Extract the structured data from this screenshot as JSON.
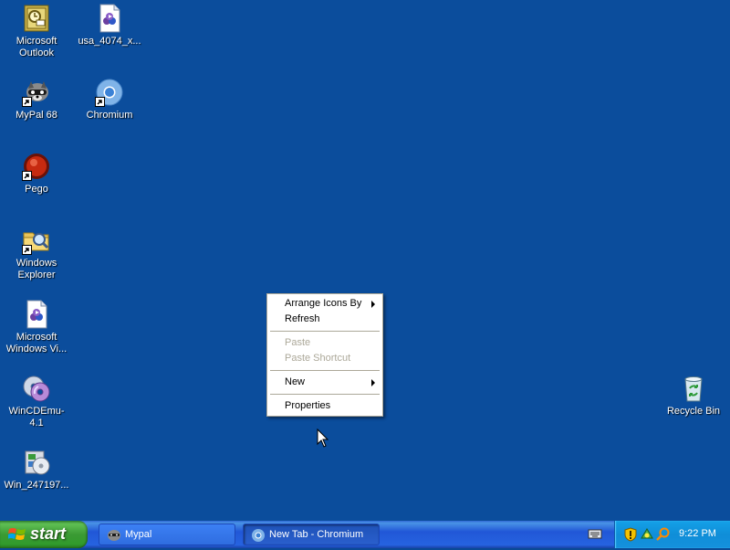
{
  "desktop": {
    "icons": [
      {
        "label": "Microsoft Outlook",
        "icon": "outlook-icon"
      },
      {
        "label": "usa_4074_x...",
        "icon": "media-file-icon"
      },
      {
        "label": "MyPal 68",
        "icon": "mypal-icon"
      },
      {
        "label": "Chromium",
        "icon": "chromium-icon"
      },
      {
        "label": "Pego",
        "icon": "pego-icon"
      },
      {
        "label": "Windows Explorer",
        "icon": "explorer-icon"
      },
      {
        "label": "Microsoft Windows Vi...",
        "icon": "media-file-icon"
      },
      {
        "label": "WinCDEmu-4.1",
        "icon": "cd-icon"
      },
      {
        "label": "Win_247197...",
        "icon": "installer-icon"
      },
      {
        "label": "Recycle Bin",
        "icon": "recycle-bin-icon"
      }
    ]
  },
  "context_menu": {
    "arrange": "Arrange Icons By",
    "refresh": "Refresh",
    "paste": "Paste",
    "paste_shortcut": "Paste Shortcut",
    "new": "New",
    "properties": "Properties"
  },
  "taskbar": {
    "start_label": "start",
    "tasks": [
      {
        "label": "Mypal",
        "active": false
      },
      {
        "label": "New Tab - Chromium",
        "active": true
      }
    ],
    "clock": "9:22 PM"
  },
  "colors": {
    "desktop": "#0b4d9c",
    "taskbar": "#245edb",
    "start": "#3b9a34",
    "tray": "#0f8ed8"
  }
}
